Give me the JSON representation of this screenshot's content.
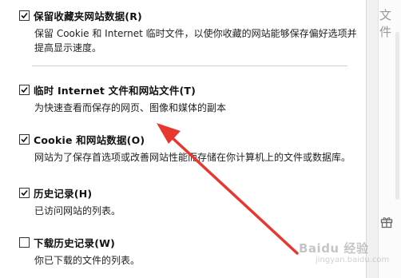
{
  "options": [
    {
      "label": "保留收藏夹网站数据(R)",
      "desc": "保留 Cookie 和 Internet 临时文件，以使你收藏的网站能够保存偏好选项并提高显示速度。",
      "checked": true
    },
    {
      "label": "临时 Internet 文件和网站文件(T)",
      "desc": "为快速查看而保存的网页、图像和媒体的副本",
      "checked": true
    },
    {
      "label": "Cookie 和网站数据(O)",
      "desc": "网站为了保存首选项或改善网站性能而存储在你计算机上的文件或数据库。",
      "checked": true
    },
    {
      "label": "历史记录(H)",
      "desc": "已访问网站的列表。",
      "checked": true
    },
    {
      "label": "下载历史记录(W)",
      "desc": "你已下载的文件的列表。",
      "checked": false
    }
  ],
  "side": {
    "text": "文件"
  },
  "watermark": {
    "text": "Baidu 经验",
    "sub": "jingyan.baidu.com"
  },
  "colors": {
    "arrow": "#e8372e"
  },
  "icons": {
    "check": "check-icon",
    "gift": "gift-icon"
  }
}
